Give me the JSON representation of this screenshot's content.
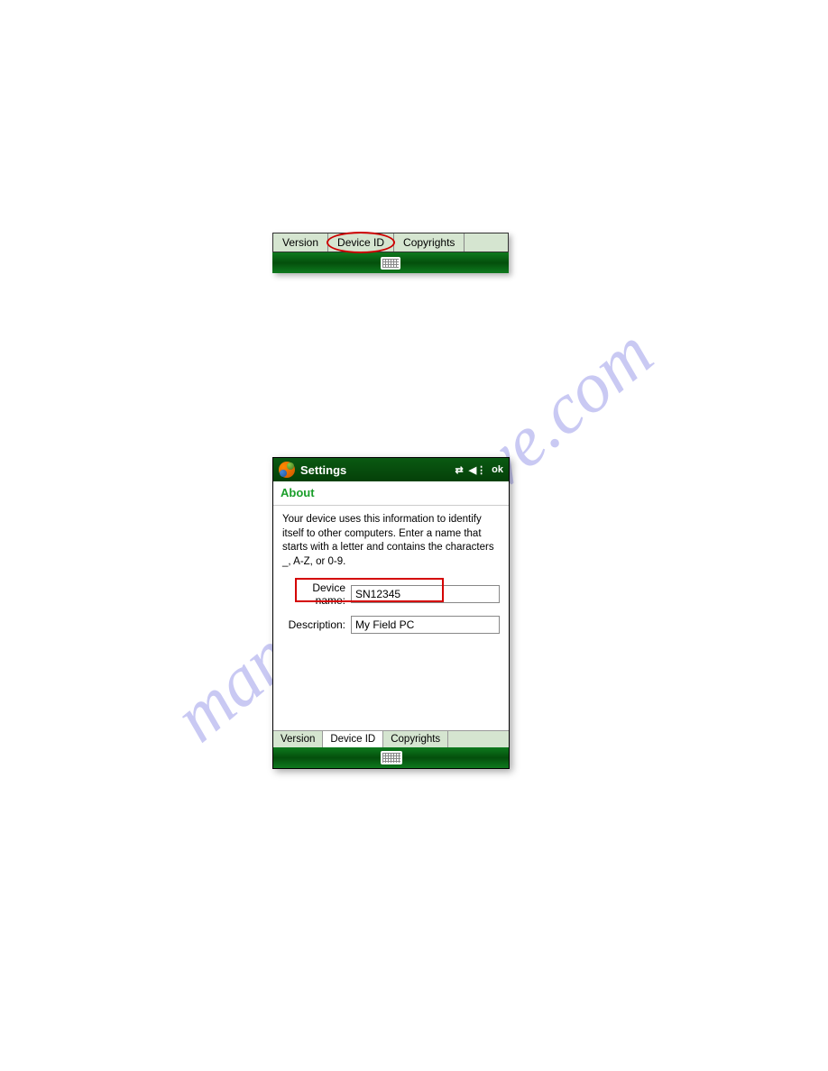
{
  "watermark": "manualsarchive.com",
  "topTabs": {
    "tabs": [
      "Version",
      "Device ID",
      "Copyrights"
    ],
    "highlightedIndex": 1
  },
  "deviceWindow": {
    "titleBar": {
      "title": "Settings",
      "okLabel": "ok"
    },
    "aboutHeader": "About",
    "infoText": "Your device uses this information to identify itself to other computers. Enter a name that starts with a letter and contains the characters _, A-Z, or 0-9.",
    "fields": {
      "deviceNameLabel": "Device name:",
      "deviceNameValue": "SN12345",
      "descriptionLabel": "Description:",
      "descriptionValue": "My Field PC"
    },
    "bottomTabs": {
      "tabs": [
        "Version",
        "Device ID",
        "Copyrights"
      ],
      "activeIndex": 1
    }
  }
}
